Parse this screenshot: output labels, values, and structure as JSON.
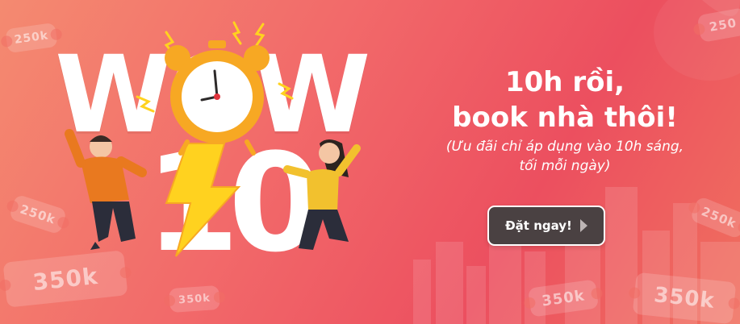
{
  "promo": {
    "headline_line1": "10h rồi,",
    "headline_line2": "book nhà thôi!",
    "note_line1": "(Ưu đãi chỉ áp dụng vào 10h sáng,",
    "note_line2": "tối mỗi ngày)",
    "cta_label": "Đặt ngay!"
  },
  "artwork": {
    "wow_text": "WOW",
    "ten_text": "10"
  },
  "vouchers": {
    "v1": "250k",
    "v2": "250k",
    "v3": "350k",
    "v4": "350k",
    "v5": "250",
    "v6": "250k",
    "v7": "350k",
    "v8": "350k"
  },
  "icons": {
    "clock": "alarm-clock-icon",
    "lightning": "lightning-bolt-icon",
    "arrow": "chevron-right-icon"
  },
  "colors": {
    "background_start": "#f48a70",
    "background_end": "#ec4f5f",
    "cta_background": "#4a4142",
    "clock_orange": "#f7a823",
    "bolt_yellow": "#ffd21f"
  }
}
